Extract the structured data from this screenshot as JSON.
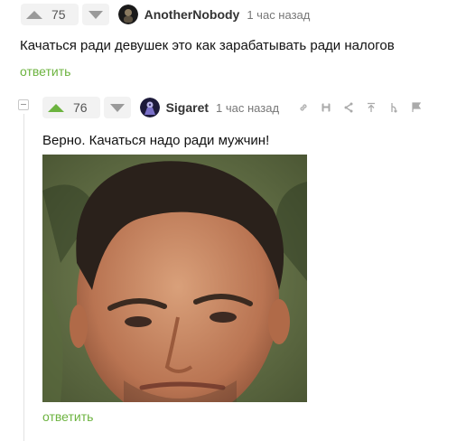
{
  "comments": [
    {
      "rating": "75",
      "author": "AnotherNobody",
      "time": "1 час назад",
      "text": "Качаться ради девушек это как зарабатывать ради налогов",
      "reply_label": "ответить"
    },
    {
      "rating": "76",
      "author": "Sigaret",
      "time": "1 час назад",
      "text": "Верно. Качаться надо ради мужчин!",
      "reply_label": "ответить",
      "tools": [
        "link-icon",
        "save-icon",
        "share-icon",
        "go-to-parent-icon",
        "branch-icon",
        "report-flag-icon"
      ]
    }
  ],
  "colors": {
    "accent_green": "#6cb33f",
    "muted_gray": "#9a9a9a",
    "vote_bg": "#f2f2f2"
  }
}
